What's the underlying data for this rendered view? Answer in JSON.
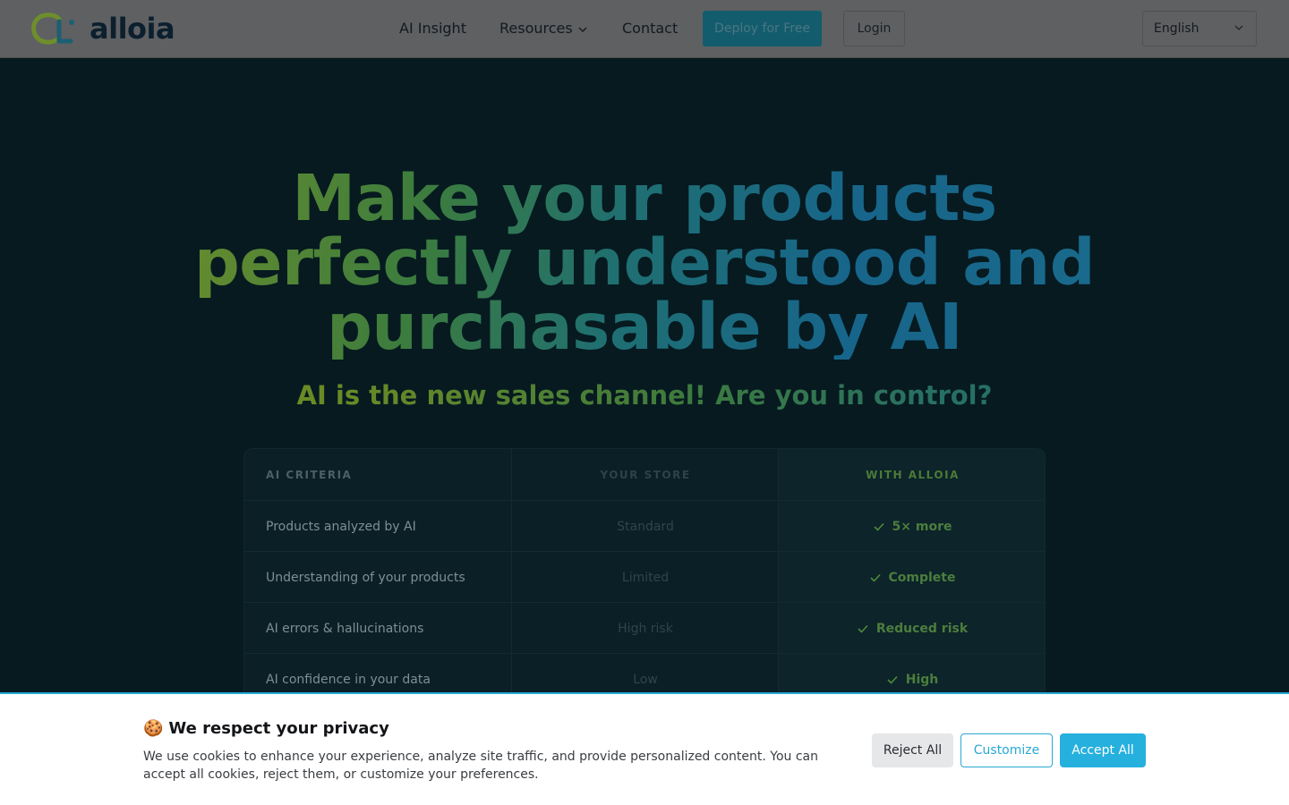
{
  "header": {
    "logo_text": "alloia",
    "nav": {
      "ai_insight": "AI Insight",
      "resources": "Resources",
      "contact": "Contact"
    },
    "deploy_label": "Deploy for Free",
    "login_label": "Login",
    "language": "English"
  },
  "hero": {
    "title_line1": "Make your products",
    "title_line2": "perfectly understood and",
    "title_line3": "purchasable by AI",
    "subtitle": "AI is the new sales channel! Are you in control?"
  },
  "comparison": {
    "headers": [
      "AI CRITERIA",
      "YOUR STORE",
      "WITH ALLOIA"
    ],
    "rows": [
      {
        "criteria": "Products analyzed by AI",
        "store": "Standard",
        "alloia": "5× more"
      },
      {
        "criteria": "Understanding of your products",
        "store": "Limited",
        "alloia": "Complete"
      },
      {
        "criteria": "AI errors & hallucinations",
        "store": "High risk",
        "alloia": "Reduced risk"
      },
      {
        "criteria": "AI confidence in your data",
        "store": "Low",
        "alloia": "High"
      }
    ]
  },
  "cookie": {
    "emoji": "🍪",
    "title": "We respect your privacy",
    "text": "We use cookies to enhance your experience, analyze site traffic, and provide personalized content. You can accept all cookies, reject them, or customize your preferences.",
    "reject_label": "Reject All",
    "customize_label": "Customize",
    "accept_label": "Accept All"
  },
  "colors": {
    "brand_accent": "#25b0de",
    "brand_green": "#6f8f2a",
    "page_bg": "#061a20"
  }
}
